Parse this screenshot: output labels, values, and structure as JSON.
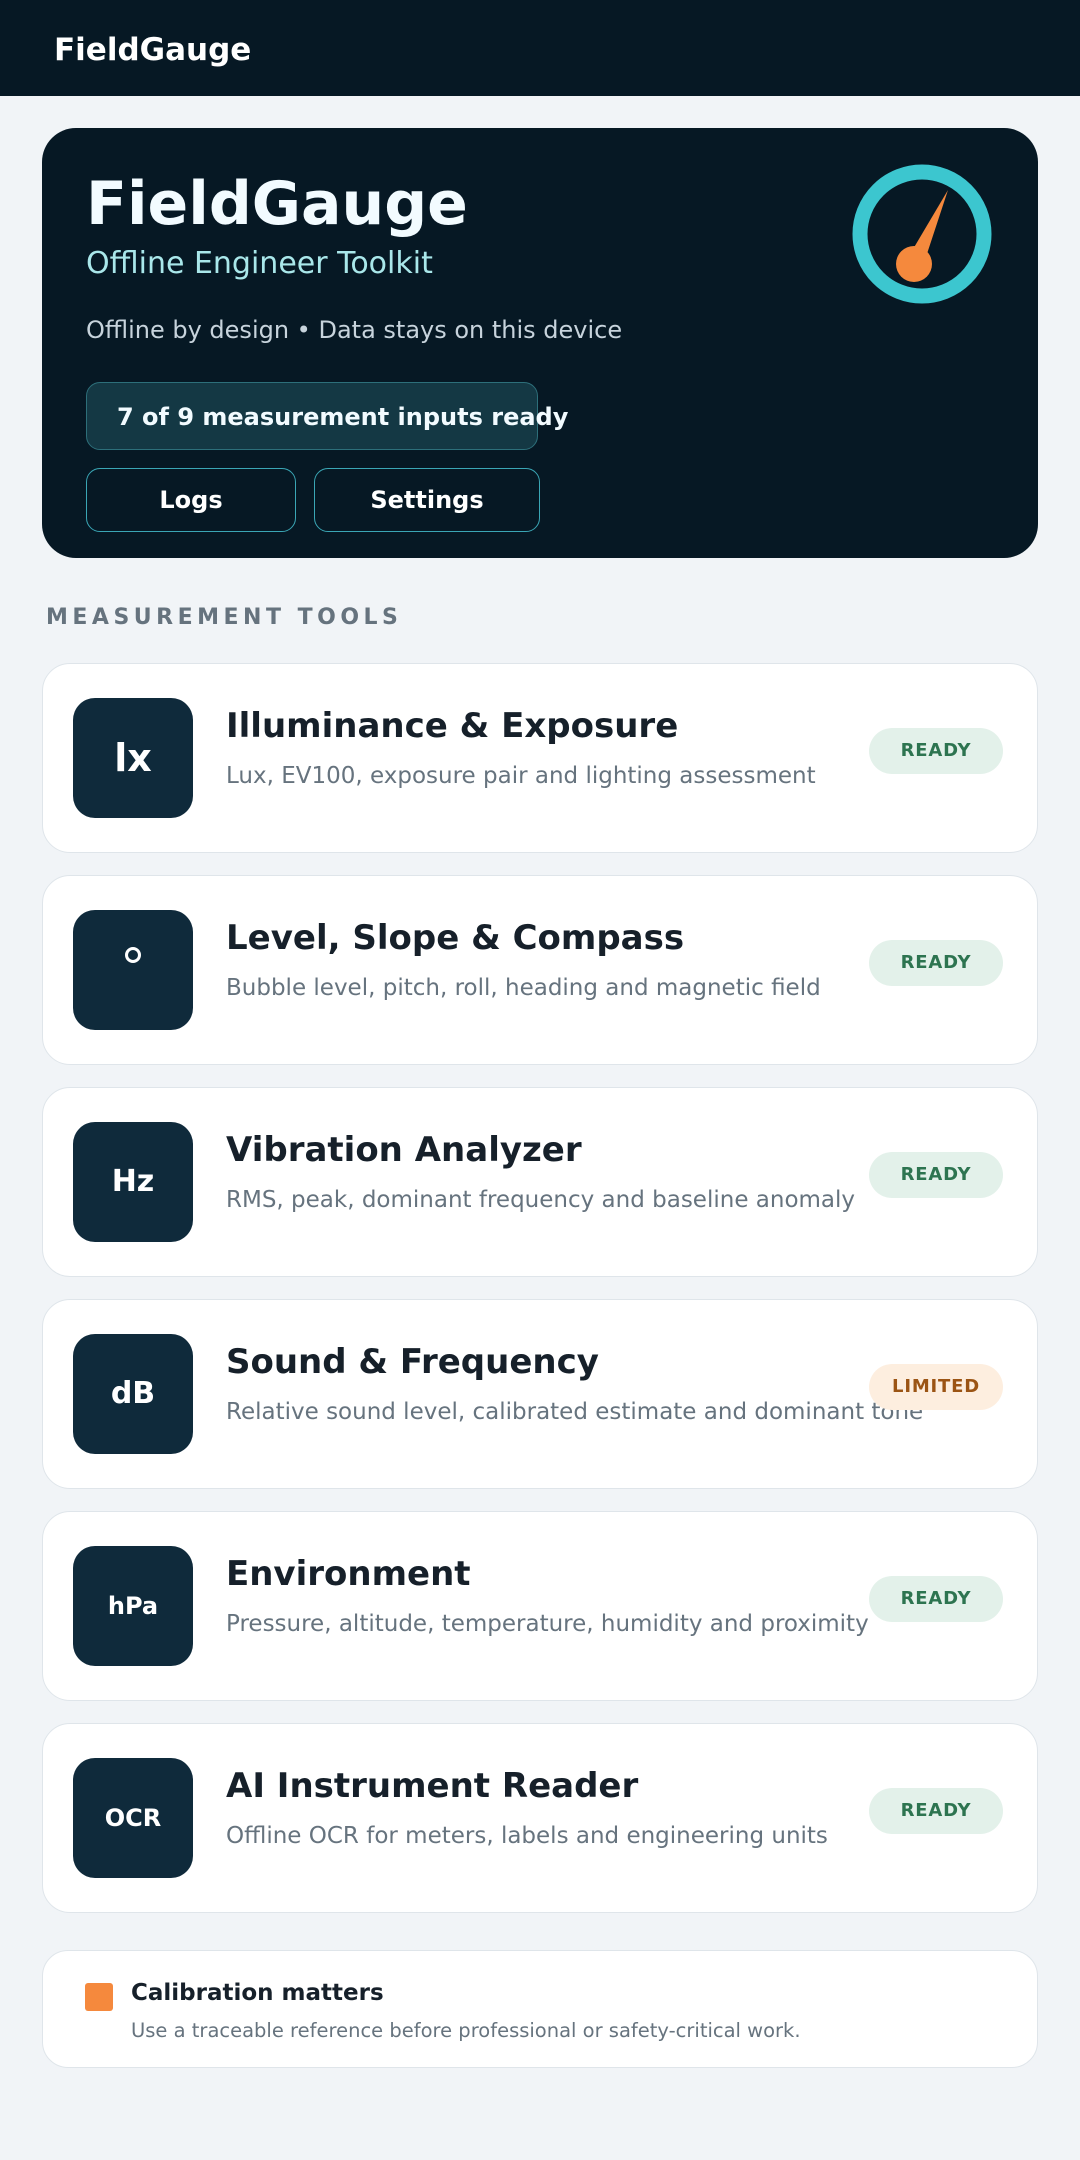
{
  "app": {
    "bar_title": "FieldGauge"
  },
  "hero": {
    "title": "FieldGauge",
    "subtitle": "Offline Engineer Toolkit",
    "tagline": "Offline by design • Data stays on this device",
    "ready_status": "7 of 9 measurement inputs ready",
    "buttons": {
      "logs": "Logs",
      "settings": "Settings"
    },
    "icon": "gauge-icon"
  },
  "section": {
    "heading": "MEASUREMENT TOOLS"
  },
  "tools": [
    {
      "icon_label": "lx",
      "title": "Illuminance & Exposure",
      "description": "Lux, EV100, exposure pair and lighting assessment",
      "status": "READY"
    },
    {
      "icon_label": "°",
      "title": "Level, Slope & Compass",
      "description": "Bubble level, pitch, roll, heading and magnetic field",
      "status": "READY"
    },
    {
      "icon_label": "Hz",
      "title": "Vibration Analyzer",
      "description": "RMS, peak, dominant frequency and baseline anomaly",
      "status": "READY"
    },
    {
      "icon_label": "dB",
      "title": "Sound & Frequency",
      "description": "Relative sound level, calibrated estimate and dominant tone",
      "status": "LIMITED"
    },
    {
      "icon_label": "hPa",
      "title": "Environment",
      "description": "Pressure, altitude, temperature, humidity and proximity",
      "status": "READY"
    },
    {
      "icon_label": "OCR",
      "title": "AI Instrument Reader",
      "description": "Offline OCR for meters, labels and engineering units",
      "status": "READY"
    }
  ],
  "note": {
    "title": "Calibration matters",
    "description": "Use a traceable reference before professional or safety-critical work."
  },
  "colors": {
    "dark_navy": "#061824",
    "tool_icon_bg": "#0f2a3b",
    "teal_accent": "#3cc6cf",
    "orange_accent": "#f5893d",
    "ready_bg": "#e3f1ea",
    "ready_text": "#2d7450",
    "limited_bg": "#fdeedf",
    "limited_text": "#9b5414",
    "page_bg": "#f1f4f7"
  }
}
